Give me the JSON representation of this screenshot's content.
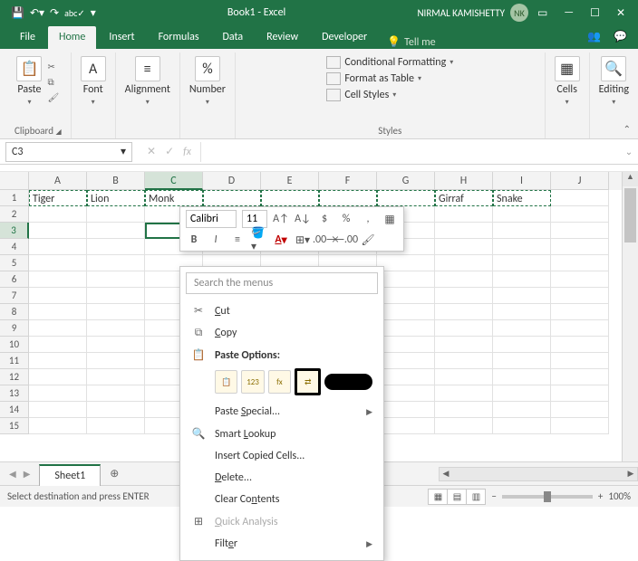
{
  "titlebar": {
    "doc": "Book1 - Excel",
    "user": "NIRMAL KAMISHETTY",
    "initials": "NK"
  },
  "tabs": {
    "file": "File",
    "home": "Home",
    "insert": "Insert",
    "formulas": "Formulas",
    "data": "Data",
    "review": "Review",
    "developer": "Developer",
    "tellme": "Tell me"
  },
  "ribbon": {
    "clipboard": {
      "label": "Clipboard",
      "paste": "Paste"
    },
    "font": {
      "label": "Font"
    },
    "alignment": {
      "label": "Alignment"
    },
    "number": {
      "label": "Number"
    },
    "styles": {
      "label": "Styles",
      "cond": "Conditional Formatting",
      "table": "Format as Table",
      "cell": "Cell Styles"
    },
    "cells": {
      "label": "Cells"
    },
    "editing": {
      "label": "Editing"
    }
  },
  "namebox": "C3",
  "fx": "fx",
  "columns": [
    "A",
    "B",
    "C",
    "D",
    "E",
    "F",
    "G",
    "H",
    "I",
    "J"
  ],
  "row1": {
    "A": "Tiger",
    "B": "Lion",
    "C": "Monk",
    "H": "Girraf",
    "I": "Snake"
  },
  "sheet": {
    "name": "Sheet1"
  },
  "status": {
    "msg": "Select destination and press ENTER",
    "zoom": "100%"
  },
  "mini": {
    "font": "Calibri",
    "size": "11"
  },
  "ctx": {
    "search": "Search the menus",
    "cut": "Cut",
    "copy": "Copy",
    "paste_options": "Paste Options:",
    "paste_special": "Paste Special...",
    "smart_lookup": "Smart Lookup",
    "insert_copied": "Insert Copied Cells...",
    "delete": "Delete...",
    "clear": "Clear Contents",
    "quick": "Quick Analysis",
    "filter": "Filter",
    "po_values": "123",
    "po_formulas": "fx"
  }
}
